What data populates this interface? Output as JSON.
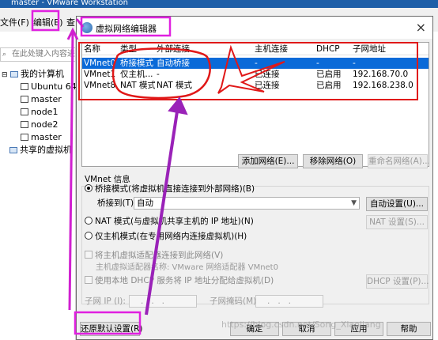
{
  "app": {
    "title": "master - VMware Workstation"
  },
  "menubar": {
    "file": "文件(F)",
    "edit": "编辑(E)",
    "view": "查"
  },
  "sidebar": {
    "search_placeholder": "在此处键入内容进",
    "tree": {
      "root": "我的计算机",
      "vms": [
        "Ubuntu 64",
        "master",
        "node1",
        "node2",
        "master"
      ],
      "shared": "共享的虚拟机"
    }
  },
  "dialog": {
    "title": "虚拟网络编辑器",
    "close": "×",
    "table": {
      "headers": [
        "名称",
        "类型",
        "外部连接",
        "主机连接",
        "DHCP",
        "子网地址"
      ],
      "rows": [
        {
          "name": "VMnet0",
          "type": "桥接模式",
          "external": "自动桥接",
          "host": "-",
          "dhcp": "-",
          "subnet": "-"
        },
        {
          "name": "VMnet1",
          "type": "仅主机...",
          "external": "-",
          "host": "已连接",
          "dhcp": "已启用",
          "subnet": "192.168.70.0"
        },
        {
          "name": "VMnet8",
          "type": "NAT 模式",
          "external": "NAT 模式",
          "host": "已连接",
          "dhcp": "已启用",
          "subnet": "192.168.238.0"
        }
      ]
    },
    "network_buttons": {
      "add": "添加网络(E)...",
      "remove": "移除网络(O)",
      "rename": "重命名网络(A)..."
    },
    "info": {
      "title": "VMnet 信息",
      "bridge_radio": "桥接模式(将虚拟机直接连接到外部网络)(B)",
      "bridge_to_label": "桥接到(T):",
      "bridge_to_value": "自动",
      "auto_settings": "自动设置(U)...",
      "nat_radio": "NAT 模式(与虚拟机共享主机的 IP 地址)(N)",
      "nat_settings": "NAT 设置(S)...",
      "host_only_radio": "仅主机模式(在专用网络内连接虚拟机)(H)",
      "connect_adapter": "将主机虚拟适配器连接到此网络(V)",
      "adapter_name": "主机虚拟适配器名称: VMware 网络适配器 VMnet0",
      "use_dhcp": "使用本地 DHCP 服务将 IP 地址分配给虚拟机(D)",
      "dhcp_settings": "DHCP 设置(P)...",
      "subnet_ip_label": "子网 IP (I):",
      "subnet_mask_label": "子网掩码(M):",
      "ip_placeholder": "...",
      "mask_placeholder": "..."
    },
    "footer": {
      "restore": "还原默认设置(R)",
      "ok": "确定",
      "cancel": "取消",
      "apply": "应用",
      "help": "帮助"
    }
  },
  "watermark": "https://blog.csdn.net/Song_Xiaoliang",
  "colors": {
    "annotation_magenta": "#e020e0",
    "annotation_red": "#e01818",
    "annotation_purple": "#9a22b8",
    "selection": "#0a6ad8"
  }
}
